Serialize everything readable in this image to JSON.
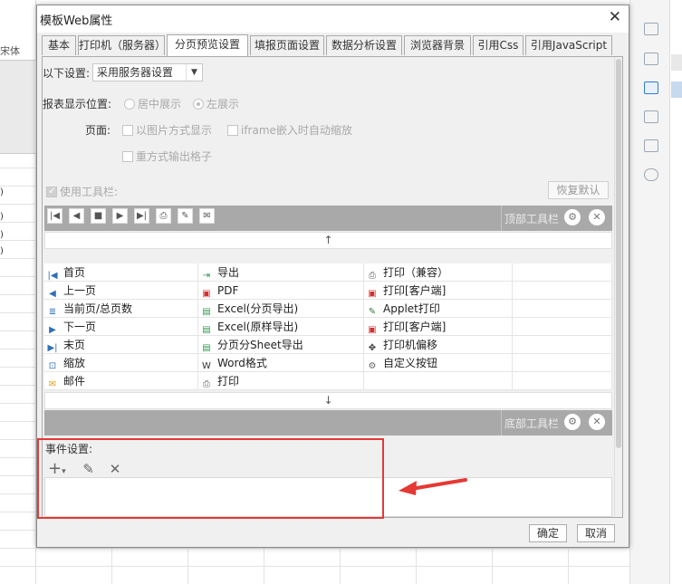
{
  "background": {
    "left_label": "宋体",
    "row_marks": [
      ")",
      ")",
      ")",
      ")"
    ]
  },
  "dialog": {
    "title": "模板Web属性",
    "close_glyph": "✕",
    "tabs": [
      "基本",
      "打印机（服务器）",
      "分页预览设置",
      "填报页面设置",
      "数据分析设置",
      "浏览器背景",
      "引用Css",
      "引用JavaScript"
    ],
    "active_tab": "分页预览设置"
  },
  "settings": {
    "mode_label": "以下设置:",
    "mode_value": "采用服务器设置",
    "position_label": "报表显示位置:",
    "position_center": "居中展示",
    "position_left": "左展示",
    "page_label": "页面:",
    "opt_image": "以图片方式显示",
    "opt_iframe": "iframe嵌入时自动缩放",
    "opt_repeat": "重方式输出格子",
    "use_toolbar": "使用工具栏:",
    "reset_default": "恢复默认"
  },
  "toolbar_preview": {
    "top_label": "顶部工具栏",
    "bottom_label": "底部工具栏",
    "up_arrow": "↑",
    "down_arrow": "↓",
    "button_grid": [
      {
        "col": 0,
        "row": 0,
        "icon": "first-page-icon",
        "glyph": "|◀",
        "color": "#2f6fb7",
        "label": "首页"
      },
      {
        "col": 0,
        "row": 1,
        "icon": "prev-page-icon",
        "glyph": "◀",
        "color": "#2f6fb7",
        "label": "上一页"
      },
      {
        "col": 0,
        "row": 2,
        "icon": "page-count-icon",
        "glyph": "≣",
        "color": "#2f6fb7",
        "label": "当前页/总页数"
      },
      {
        "col": 0,
        "row": 3,
        "icon": "next-page-icon",
        "glyph": "▶",
        "color": "#2f6fb7",
        "label": "下一页"
      },
      {
        "col": 0,
        "row": 4,
        "icon": "last-page-icon",
        "glyph": "▶|",
        "color": "#2f6fb7",
        "label": "末页"
      },
      {
        "col": 0,
        "row": 5,
        "icon": "zoom-icon",
        "glyph": "⊡",
        "color": "#2f6fb7",
        "label": "缩放"
      },
      {
        "col": 0,
        "row": 6,
        "icon": "mail-icon",
        "glyph": "✉",
        "color": "#e0a020",
        "label": "邮件"
      },
      {
        "col": 1,
        "row": 0,
        "icon": "export-icon",
        "glyph": "⇥",
        "color": "#2e9a4b",
        "label": "导出"
      },
      {
        "col": 1,
        "row": 1,
        "icon": "pdf-icon",
        "glyph": "▣",
        "color": "#d32f2f",
        "label": "PDF"
      },
      {
        "col": 1,
        "row": 2,
        "icon": "excel-icon",
        "glyph": "▤",
        "color": "#2e9a4b",
        "label": "Excel(分页导出)"
      },
      {
        "col": 1,
        "row": 3,
        "icon": "excel-icon",
        "glyph": "▤",
        "color": "#2e9a4b",
        "label": "Excel(原样导出)"
      },
      {
        "col": 1,
        "row": 4,
        "icon": "excel-icon",
        "glyph": "▤",
        "color": "#2e9a4b",
        "label": "分页分Sheet导出"
      },
      {
        "col": 1,
        "row": 5,
        "icon": "word-icon",
        "glyph": "W",
        "color": "#333333",
        "label": "Word格式"
      },
      {
        "col": 1,
        "row": 6,
        "icon": "print-icon",
        "glyph": "⎙",
        "color": "#666666",
        "label": "打印"
      },
      {
        "col": 2,
        "row": 0,
        "icon": "print-icon",
        "glyph": "⎙",
        "color": "#666666",
        "label": "打印（兼容）"
      },
      {
        "col": 2,
        "row": 1,
        "icon": "print-client-icon",
        "glyph": "▣",
        "color": "#d32f2f",
        "label": "打印[客户端]"
      },
      {
        "col": 2,
        "row": 2,
        "icon": "applet-print-icon",
        "glyph": "✎",
        "color": "#2e7d32",
        "label": "Applet打印"
      },
      {
        "col": 2,
        "row": 3,
        "icon": "print-client-icon",
        "glyph": "▣",
        "color": "#d32f2f",
        "label": "打印[客户端]"
      },
      {
        "col": 2,
        "row": 4,
        "icon": "move-icon",
        "glyph": "✥",
        "color": "#333333",
        "label": "打印机偏移"
      },
      {
        "col": 2,
        "row": 5,
        "icon": "gear-icon",
        "glyph": "⚙",
        "color": "#666666",
        "label": "自定义按钮"
      }
    ]
  },
  "events": {
    "label": "事件设置:",
    "add_glyph": "+",
    "edit_glyph": "✎",
    "delete_glyph": "✕"
  },
  "footer": {
    "ok": "确定",
    "cancel": "取消"
  },
  "colors": {
    "toolbar_gray": "#a9a9a9",
    "highlight_red": "#e53935"
  }
}
